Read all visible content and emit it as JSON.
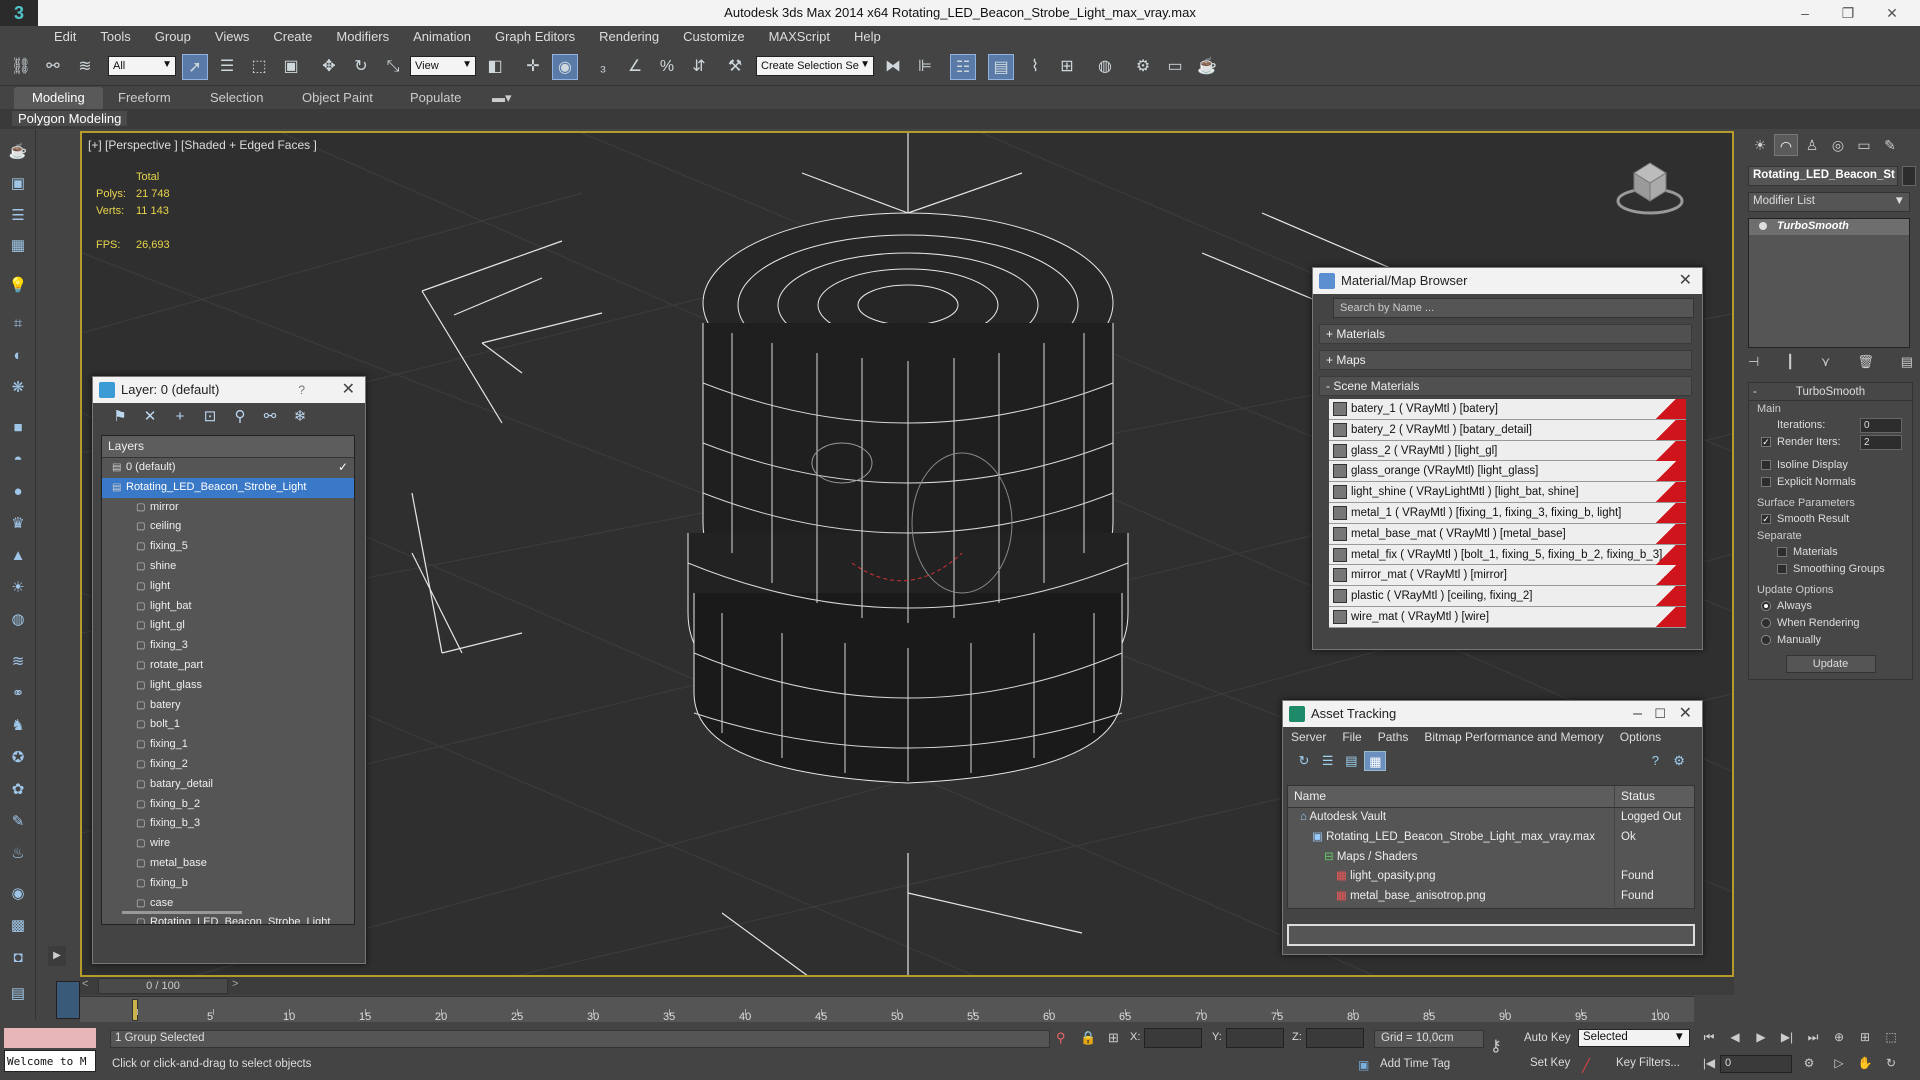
{
  "app": {
    "logo": "3",
    "title": "Autodesk 3ds Max  2014 x64      Rotating_LED_Beacon_Strobe_Light_max_vray.max",
    "win_min": "–",
    "win_max": "❐",
    "win_close": "✕"
  },
  "menu": [
    "Edit",
    "Tools",
    "Group",
    "Views",
    "Create",
    "Modifiers",
    "Animation",
    "Graph Editors",
    "Rendering",
    "Customize",
    "MAXScript",
    "Help"
  ],
  "toolbar": {
    "filter_value": "All",
    "refcoord_value": "View",
    "selection_set_placeholder": "Create Selection Se"
  },
  "ribbon": {
    "tabs": [
      "Modeling",
      "Freeform",
      "Selection",
      "Object Paint",
      "Populate"
    ],
    "active_tab": "Modeling",
    "sub_label": "Polygon Modeling"
  },
  "viewport": {
    "label": "[+] [Perspective ] [Shaded + Edged Faces ]",
    "stats": {
      "total_label": "Total",
      "polys_label": "Polys:",
      "polys_value": "21 748",
      "verts_label": "Verts:",
      "verts_value": "11 143",
      "fps_label": "FPS:",
      "fps_value": "26,693"
    }
  },
  "layers_panel": {
    "title": "Layer: 0 (default)",
    "help": "?",
    "close": "✕",
    "header": "Layers",
    "rows": [
      {
        "label": "0 (default)",
        "level": 0,
        "selected": false,
        "check": "✓"
      },
      {
        "label": "Rotating_LED_Beacon_Strobe_Light",
        "level": 0,
        "selected": true,
        "check": ""
      },
      {
        "label": "mirror",
        "level": 1
      },
      {
        "label": "ceiling",
        "level": 1
      },
      {
        "label": "fixing_5",
        "level": 1
      },
      {
        "label": "shine",
        "level": 1
      },
      {
        "label": "light",
        "level": 1
      },
      {
        "label": "light_bat",
        "level": 1
      },
      {
        "label": "light_gl",
        "level": 1
      },
      {
        "label": "fixing_3",
        "level": 1
      },
      {
        "label": "rotate_part",
        "level": 1
      },
      {
        "label": "light_glass",
        "level": 1
      },
      {
        "label": "batery",
        "level": 1
      },
      {
        "label": "bolt_1",
        "level": 1
      },
      {
        "label": "fixing_1",
        "level": 1
      },
      {
        "label": "fixing_2",
        "level": 1
      },
      {
        "label": "batary_detail",
        "level": 1
      },
      {
        "label": "fixing_b_2",
        "level": 1
      },
      {
        "label": "fixing_b_3",
        "level": 1
      },
      {
        "label": "wire",
        "level": 1
      },
      {
        "label": "metal_base",
        "level": 1
      },
      {
        "label": "fixing_b",
        "level": 1
      },
      {
        "label": "case",
        "level": 1
      },
      {
        "label": "Rotating_LED_Beacon_Strobe_Light",
        "level": 1
      }
    ]
  },
  "material_browser": {
    "title": "Material/Map Browser",
    "close": "✕",
    "search_placeholder": "Search by Name ...",
    "sections": [
      "+ Materials",
      "+ Maps",
      "- Scene Materials"
    ],
    "materials": [
      "batery_1  ( VRayMtl )  [batery]",
      "batery_2  ( VRayMtl )  [batary_detail]",
      "glass_2  ( VRayMtl )  [light_gl]",
      "glass_orange  (VRayMtl)  [light_glass]",
      "light_shine  ( VRayLightMtl )  [light_bat, shine]",
      "metal_1  ( VRayMtl )  [fixing_1, fixing_3, fixing_b, light]",
      "metal_base_mat  ( VRayMtl )  [metal_base]",
      "metal_fix  ( VRayMtl )  [bolt_1, fixing_5, fixing_b_2, fixing_b_3]",
      "mirror_mat  ( VRayMtl )  [mirror]",
      "plastic  ( VRayMtl )  [ceiling, fixing_2]",
      "wire_mat  ( VRayMtl )  [wire]"
    ]
  },
  "asset_tracking": {
    "title": "Asset Tracking",
    "menu": [
      "Server",
      "File",
      "Paths",
      "Bitmap Performance and Memory",
      "Options"
    ],
    "columns": [
      "Name",
      "Status"
    ],
    "rows": [
      {
        "name": "Autodesk Vault",
        "status": "Logged Out",
        "indent": 1
      },
      {
        "name": "Rotating_LED_Beacon_Strobe_Light_max_vray.max",
        "status": "Ok",
        "indent": 2
      },
      {
        "name": "Maps / Shaders",
        "status": "",
        "indent": 3
      },
      {
        "name": "light_opasity.png",
        "status": "Found",
        "indent": 4
      },
      {
        "name": "metal_base_anisotrop.png",
        "status": "Found",
        "indent": 4
      }
    ]
  },
  "command_panel": {
    "object_name": "Rotating_LED_Beacon_St",
    "modifier_list": "Modifier List",
    "modifier": "TurboSmooth",
    "rollout_title": "TurboSmooth",
    "main_label": "Main",
    "iterations_label": "Iterations:",
    "iterations_value": "0",
    "render_iters_label": "Render Iters:",
    "render_iters_value": "2",
    "isoline_label": "Isoline Display",
    "explicit_label": "Explicit Normals",
    "surface_label": "Surface Parameters",
    "smooth_label": "Smooth Result",
    "separate_label": "Separate",
    "materials_label": "Materials",
    "smoothing_label": "Smoothing Groups",
    "update_label": "Update Options",
    "always_label": "Always",
    "when_rendering_label": "When Rendering",
    "manually_label": "Manually",
    "update_button": "Update",
    "collapse_sign": "-"
  },
  "timeline": {
    "position": "0 / 100",
    "ticks": [
      "5",
      "10",
      "15",
      "20",
      "25",
      "30",
      "35",
      "40",
      "45",
      "50",
      "55",
      "60",
      "65",
      "70",
      "75",
      "80",
      "85",
      "90",
      "95",
      "100"
    ]
  },
  "status": {
    "maxscript_text": "Welcome to M",
    "selection_info": "1 Group Selected",
    "hint": "Click or click-and-drag to select objects",
    "x_label": "X:",
    "y_label": "Y:",
    "z_label": "Z:",
    "grid": "Grid = 10,0cm",
    "add_time_tag": "Add Time Tag",
    "auto_key": "Auto Key",
    "set_key": "Set Key",
    "selected_dd": "Selected",
    "key_filters": "Key Filters...",
    "frame_value": "0"
  },
  "colors": {
    "viewport_border": "#b59b2c",
    "selection_blue": "#3a79c7",
    "material_red": "#d0141c",
    "stats_yellow": "#e8d44c"
  }
}
